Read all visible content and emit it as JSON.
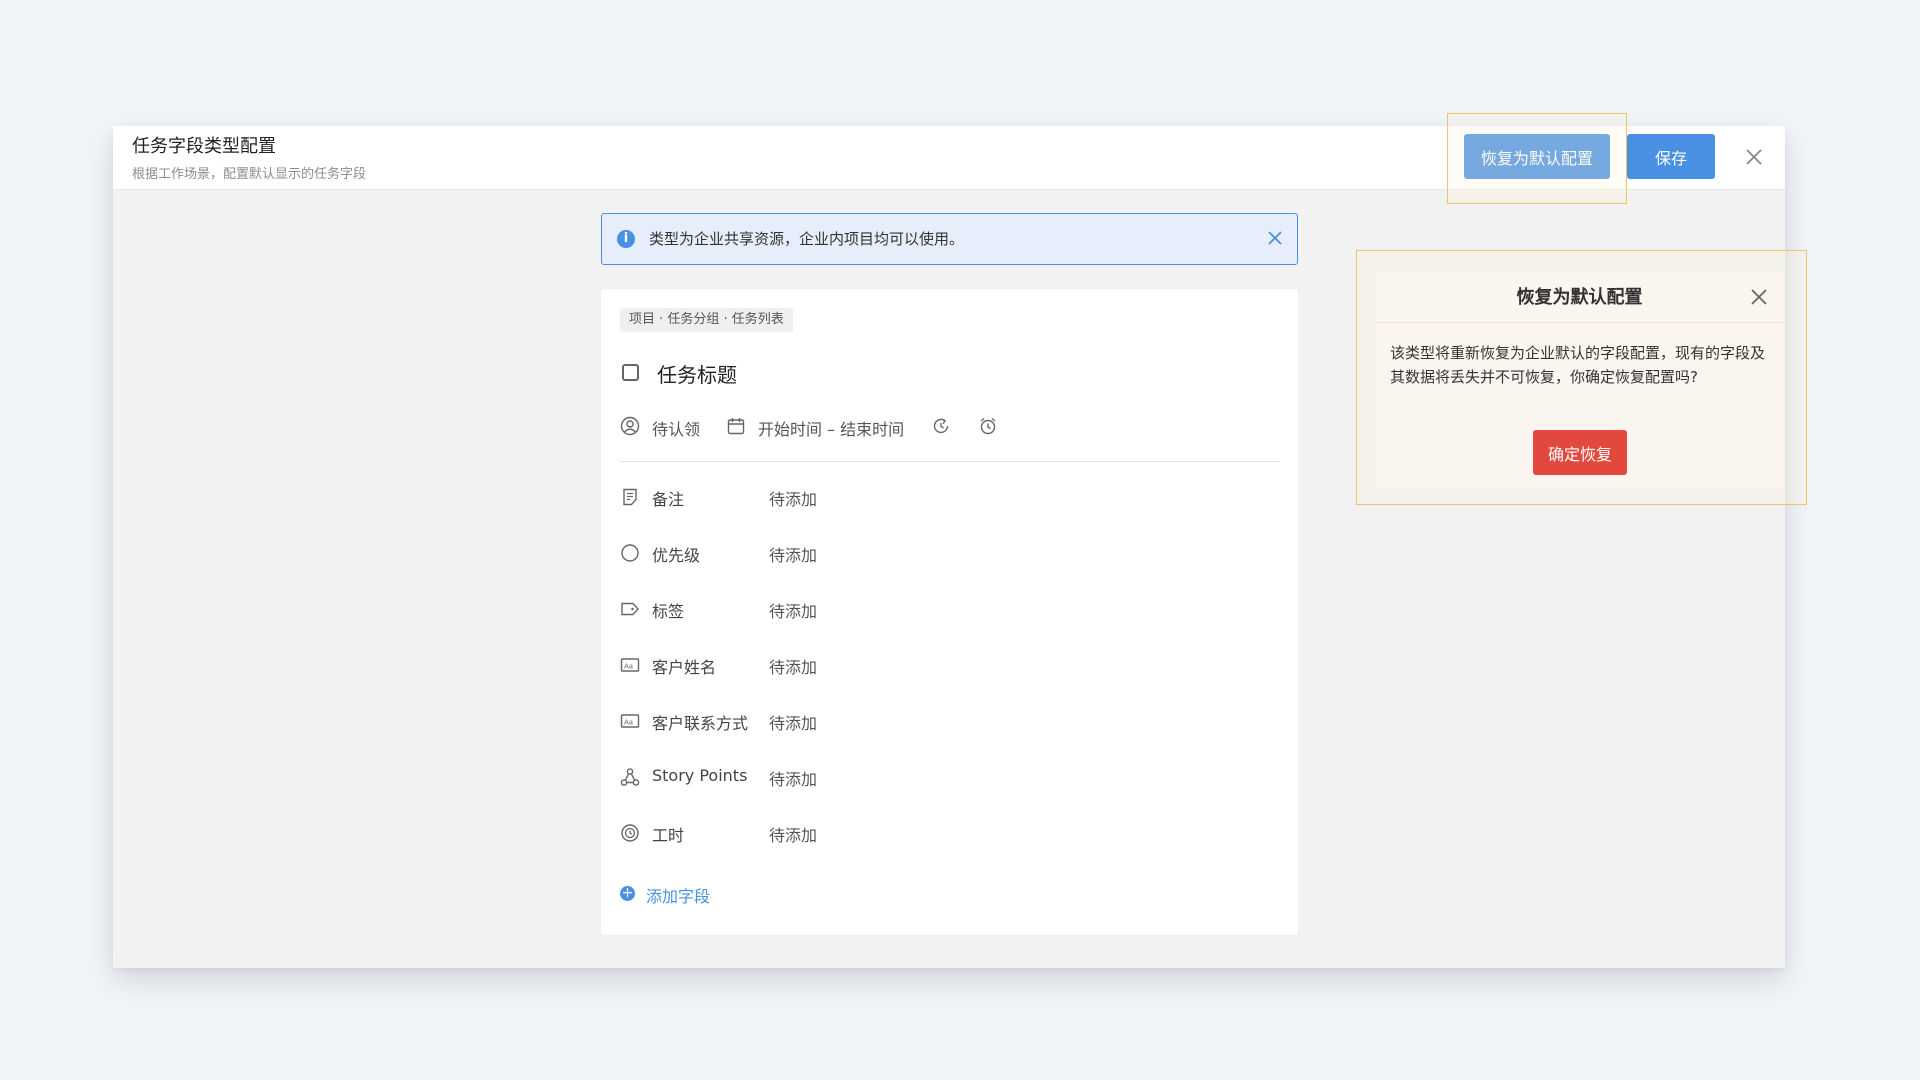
{
  "header": {
    "title": "任务字段类型配置",
    "subtitle": "根据工作场景，配置默认显示的任务字段",
    "restore_label": "恢复为默认配置",
    "save_label": "保存"
  },
  "alert": {
    "text": "类型为企业共享资源，企业内项目均可以使用。"
  },
  "card": {
    "breadcrumb": "项目 · 任务分组 · 任务列表",
    "task_title": "任务标题",
    "assignee": "待认领",
    "time_range": "开始时间 – 结束时间",
    "fields": [
      {
        "icon": "note-icon",
        "label": "备注",
        "value": "待添加"
      },
      {
        "icon": "priority-circle-icon",
        "label": "优先级",
        "value": "待添加"
      },
      {
        "icon": "tag-icon",
        "label": "标签",
        "value": "待添加"
      },
      {
        "icon": "text-field-icon",
        "label": "客户姓名",
        "value": "待添加"
      },
      {
        "icon": "text-field-icon",
        "label": "客户联系方式",
        "value": "待添加"
      },
      {
        "icon": "story-points-icon",
        "label": "Story Points",
        "value": "待添加"
      },
      {
        "icon": "work-hours-icon",
        "label": "工时",
        "value": "待添加"
      }
    ],
    "add_field_label": "添加字段"
  },
  "popover": {
    "title": "恢复为默认配置",
    "body": "该类型将重新恢复为企业默认的字段配置，现有的字段及其数据将丢失并不可恢复，你确定恢复配置吗?",
    "confirm_label": "确定恢复"
  },
  "colors": {
    "primary": "#4a90e2",
    "danger": "#e2483d",
    "highlight_border": "#f0c36a",
    "popover_bg": "#faf6ef"
  }
}
